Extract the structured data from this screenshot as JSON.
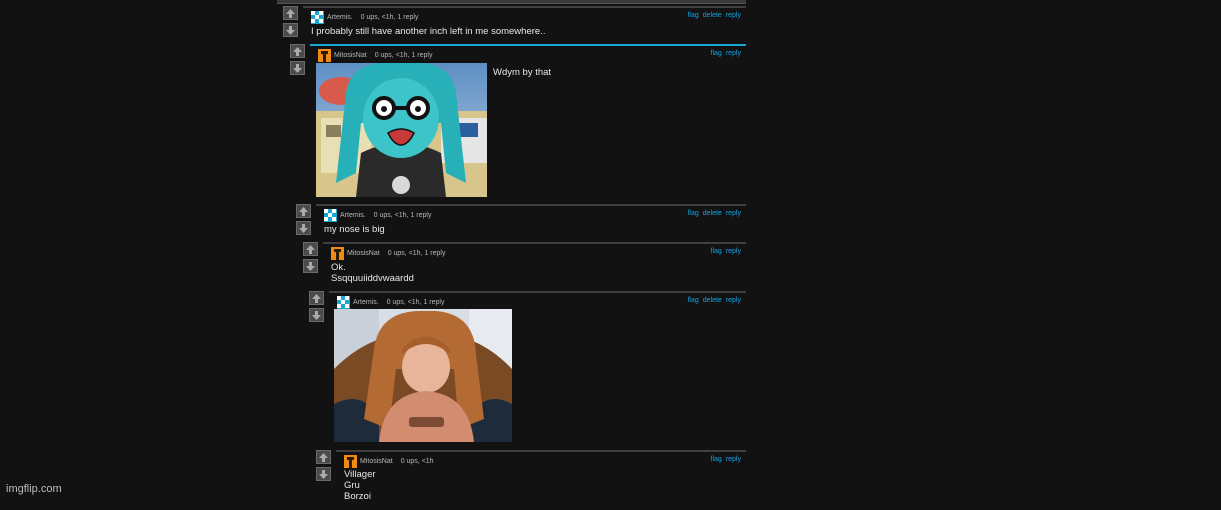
{
  "colors": {
    "background": "#121212",
    "box": "#2f2f2f",
    "link": "#18a0e0",
    "active_border": "#1aa6d2",
    "stripe_orange": "#e08a1e",
    "stripe_teal": "#1aa6d2",
    "stripe_red": "#9c3b3b",
    "stripe_purple": "#9a2aa0",
    "stripe_blue": "#3b3fb0"
  },
  "comments": [
    {
      "user": "Artemis.",
      "stats": "0 ups, <1h, 1 reply",
      "flag": "flag",
      "delete": "delete",
      "reply": "reply",
      "text": "I probably still have another inch left in me somewhere.."
    },
    {
      "user": "MitosisNat",
      "stats": "0 ups, <1h, 1 reply",
      "flag": "flag",
      "reply": "reply",
      "text": "Wdym by that",
      "image": "cartoon-meme-image"
    },
    {
      "user": "Artemis.",
      "stats": "0 ups, <1h, 1 reply",
      "flag": "flag",
      "delete": "delete",
      "reply": "reply",
      "text": "my nose is big"
    },
    {
      "user": "MitosisNat",
      "stats": "0 ups, <1h, 1 reply",
      "flag": "flag",
      "reply": "reply",
      "text": "Ok.\nSsqquuiiddvwaardd"
    },
    {
      "user": "Artemis.",
      "stats": "0 ups, <1h, 1 reply",
      "flag": "flag",
      "delete": "delete",
      "reply": "reply",
      "image": "photo-image"
    },
    {
      "user": "MitosisNat",
      "stats": "0 ups, <1h",
      "flag": "flag",
      "reply": "reply",
      "text": "Villager\nGru\nBorzoi"
    }
  ],
  "watermark": "imgflip.com",
  "icons": {
    "upvote": "up-arrow-icon",
    "downvote": "down-arrow-icon",
    "avatar_artemis": "checker-avatar-icon",
    "avatar_mitosis": "orange-avatar-icon"
  }
}
